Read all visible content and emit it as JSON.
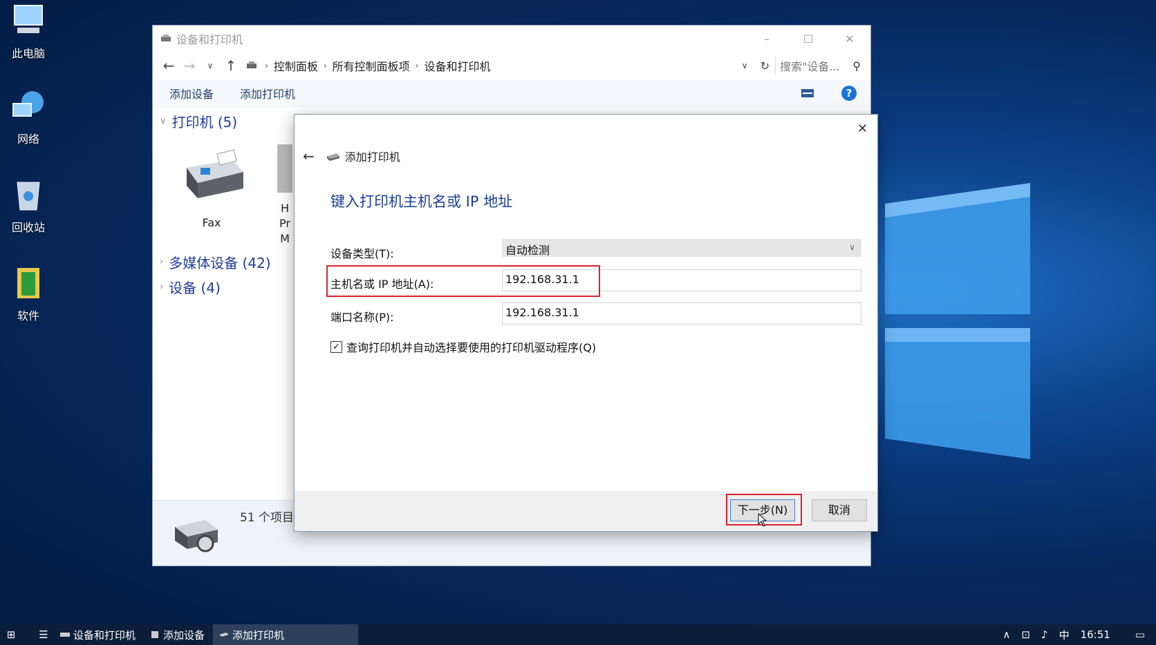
{
  "desktop": {
    "icons": [
      {
        "label": "此电脑",
        "icon": "computer-icon"
      },
      {
        "label": "网络",
        "icon": "network-icon"
      },
      {
        "label": "回收站",
        "icon": "recycle-bin-icon"
      },
      {
        "label": "软件",
        "icon": "folder-icon"
      }
    ]
  },
  "explorer": {
    "title": "设备和打印机",
    "window_controls": [
      "–",
      "☐",
      "✕"
    ],
    "breadcrumbs": [
      "控制面板",
      "所有控制面板项",
      "设备和打印机"
    ],
    "search_placeholder": "搜索\"设备...",
    "commands": [
      "添加设备",
      "添加打印机"
    ],
    "help_label": "?",
    "groups": [
      {
        "label": "打印机 (5)",
        "expanded": true
      },
      {
        "label": "多媒体设备 (42)",
        "expanded": false
      },
      {
        "label": "设备 (4)",
        "expanded": false
      }
    ],
    "device_items": [
      {
        "label": "Fax"
      },
      {
        "label": "H Pr M"
      }
    ],
    "status_count": "51 个项目"
  },
  "dialog": {
    "header": "添加打印机",
    "close_label": "✕",
    "title": "键入打印机主机名或 IP 地址",
    "fields": {
      "device_type": {
        "label": "设备类型(T):",
        "value": "自动检测"
      },
      "hostname": {
        "label": "主机名或 IP 地址(A):",
        "value": "192.168.31.1"
      },
      "port_name": {
        "label": "端口名称(P):",
        "value": "192.168.31.1"
      }
    },
    "checkbox": {
      "label": "查询打印机并自动选择要使用的打印机驱动程序(Q)",
      "checked": true
    },
    "buttons": {
      "next": "下一步(N)",
      "cancel": "取消"
    }
  },
  "taskbar": {
    "items": [
      {
        "label": "设备和打印机",
        "active": false
      },
      {
        "label": "添加设备",
        "active": false
      },
      {
        "label": "添加打印机",
        "active": true
      }
    ],
    "tray": {
      "ime": "中",
      "time": "16:51"
    }
  },
  "colors": {
    "accent": "#1a3f95",
    "highlight_box": "#e0202c",
    "desktop_bg": "#0b3f86"
  }
}
